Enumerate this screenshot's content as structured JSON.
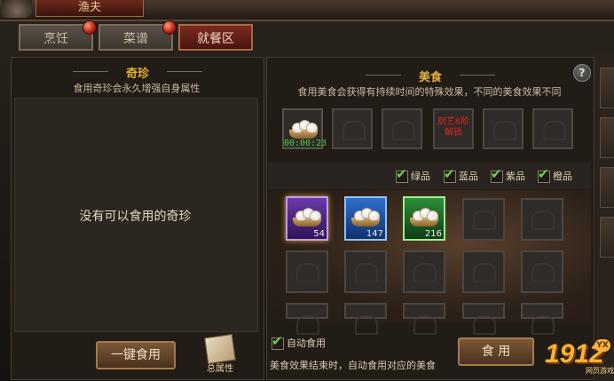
{
  "window": {
    "title": "渔夫"
  },
  "tabs": [
    {
      "label": "烹饪",
      "active": false,
      "has_alert": true
    },
    {
      "label": "菜谱",
      "active": false,
      "has_alert": true
    },
    {
      "label": "就餐区",
      "active": true,
      "has_alert": false
    }
  ],
  "left": {
    "title": "奇珍",
    "subtitle": "食用奇珍会永久增强自身属性",
    "empty_text": "没有可以食用的奇珍",
    "eat_all_button": "一键食用",
    "book_label": "总属性"
  },
  "right": {
    "title": "美食",
    "subtitle": "食用美食会获得有持续时间的特殊效果，不同的美食效果不同",
    "help_icon": "?",
    "active_slots": [
      {
        "type": "food",
        "timer": "00:00:23"
      },
      {
        "type": "empty"
      },
      {
        "type": "empty"
      },
      {
        "type": "locked",
        "text": "厨艺8阶解锁"
      },
      {
        "type": "empty"
      },
      {
        "type": "empty"
      }
    ],
    "filters": [
      {
        "label": "绿品",
        "checked": true
      },
      {
        "label": "蓝品",
        "checked": true
      },
      {
        "label": "紫品",
        "checked": true
      },
      {
        "label": "橙品",
        "checked": true
      }
    ],
    "inventory": [
      {
        "quality": "purple",
        "count": "54"
      },
      {
        "quality": "blue",
        "count": "147"
      },
      {
        "quality": "green",
        "count": "216"
      }
    ],
    "auto_eat_label": "自动食用",
    "auto_eat_checked": true,
    "eat_button": "食 用",
    "bottom_note": "美食效果结束时，自动食用对应的美食"
  },
  "watermark": {
    "number": "1912",
    "badge": "YX",
    "site": "网页游戏"
  },
  "colors": {
    "accent_gold": "#e3b23c",
    "tab_active": "#7c2a20",
    "purple": "#6a3aa8",
    "blue": "#2f6fd0",
    "green": "#2d8f38"
  }
}
